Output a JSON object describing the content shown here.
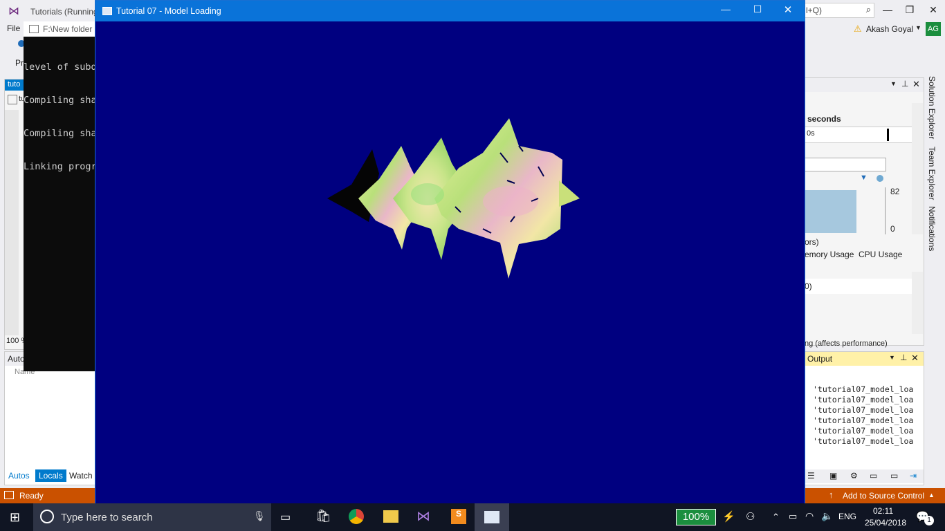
{
  "vs": {
    "title": "Tutorials (Running",
    "menu_file": "File",
    "search_hint": "l+Q)",
    "user_name": "Akash Goyal",
    "user_initials": "AG",
    "toolbar_p": "Pr",
    "left_doc_tab": "tuto",
    "left_doc_sub": "tu",
    "zoom": "100 %",
    "autos_title": "Autos",
    "autos_name_col": "Name",
    "tabs": [
      "Autos",
      "Locals",
      "Watch"
    ],
    "status": "Ready",
    "add_source_control": "Add to Source Control"
  },
  "diagnostics": {
    "seconds_label": "seconds",
    "timeline_label": "0s",
    "value_82": "82",
    "value_0": "0",
    "partial_ors": "ors)",
    "tab_memory": "emory Usage",
    "tab_cpu": "CPU Usage",
    "row_value": "0)",
    "footer_text": "ng (affects performance)"
  },
  "output": {
    "title": "Output",
    "lines": [
      "'tutorial07_model_loa",
      "'tutorial07_model_loa",
      "'tutorial07_model_loa",
      "'tutorial07_model_loa",
      "'tutorial07_model_loa",
      "'tutorial07_model_loa"
    ]
  },
  "side_tabs": [
    "Solution Explorer",
    "Team Explorer",
    "Notifications"
  ],
  "console": {
    "title": "F:\\New folder",
    "lines": [
      "level of subd",
      "Compiling sha",
      "Compiling sha",
      "Linking progr"
    ]
  },
  "gl_window": {
    "title": "Tutorial 07 - Model Loading",
    "background": "#000080"
  },
  "taskbar": {
    "search_placeholder": "Type here to search",
    "battery": "100%",
    "language": "ENG",
    "time": "02:11",
    "date": "25/04/2018",
    "notification_count": "1"
  },
  "colors": {
    "accent_blue": "#0a73d9",
    "status_orange": "#ca5100",
    "taskbar": "#101523",
    "battery_green": "#1b8e3e"
  }
}
